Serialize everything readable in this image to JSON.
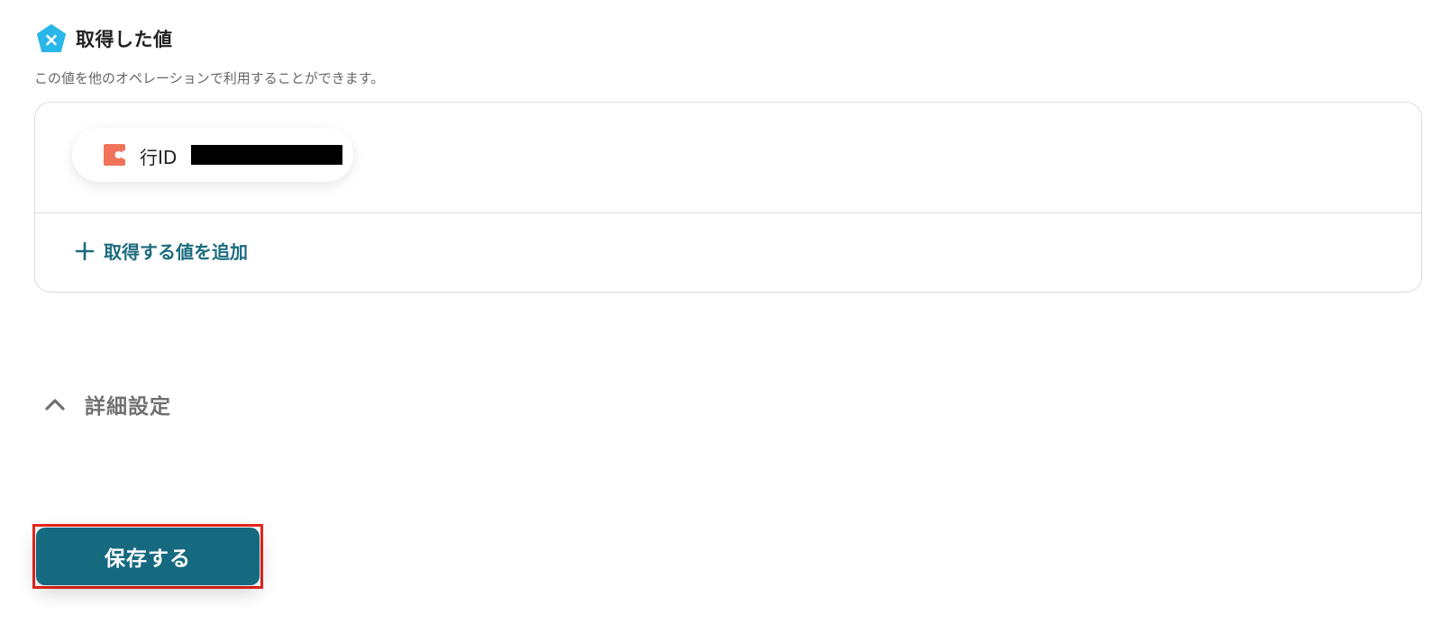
{
  "section": {
    "title": "取得した値",
    "description": "この値を他のオペレーションで利用することができます。"
  },
  "values": {
    "items": [
      {
        "label": "行ID",
        "value_redacted": true
      }
    ],
    "add_button_label": "取得する値を追加"
  },
  "details": {
    "label": "詳細設定",
    "expanded": true
  },
  "footer": {
    "save_label": "保存する"
  },
  "colors": {
    "accent": "#156a80",
    "link": "#1c6b80",
    "section_icon": "#29b6e8",
    "app_icon": "#f0735a",
    "highlight": "#e8261b"
  },
  "icons": {
    "section": "pentagon-x-icon",
    "app": "app-logo-icon",
    "add": "plus-icon",
    "toggle": "chevron-up-icon"
  }
}
